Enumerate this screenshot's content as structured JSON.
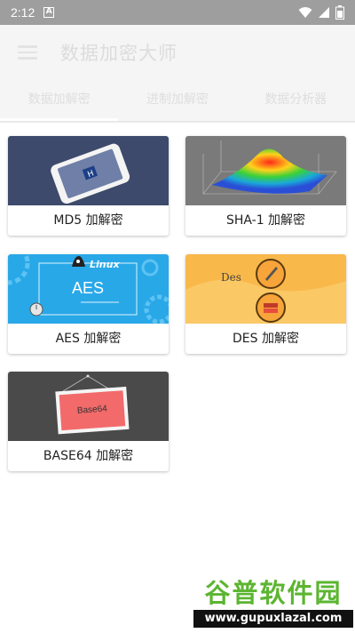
{
  "status_bar": {
    "time": "2:12",
    "notification_letter": "A"
  },
  "app_bar": {
    "title": "数据加密大师"
  },
  "tabs": [
    {
      "label": "数据加解密",
      "selected": true
    },
    {
      "label": "进制加解密",
      "selected": false
    },
    {
      "label": "数据分析器",
      "selected": false
    }
  ],
  "cards": [
    {
      "label": "MD5 加解密",
      "image": "phone-icon"
    },
    {
      "label": "SHA-1 加解密",
      "image": "3d-surface-plot"
    },
    {
      "label": "AES 加解密",
      "image": "linux-gear-banner",
      "image_text": {
        "brand": "Linux",
        "name": "AES"
      }
    },
    {
      "label": "DES 加解密",
      "image": "des-banner",
      "image_text": {
        "name": "Des"
      }
    },
    {
      "label": "BASE64 加解密",
      "image": "picture-frame",
      "image_text": {
        "frame": "Base64"
      }
    }
  ],
  "watermark": {
    "title": "谷普软件园",
    "url": "www.gupuxlazal.com"
  },
  "colors": {
    "status_bar": "#9e9e9e",
    "app_bar": "#f5f5f5",
    "md5_bg": "#3d4a6b",
    "sha_bg": "#7a7a7a",
    "aes_bg": "#29a8e8",
    "des_bg": "#f9b84a",
    "base64_bg": "#4a4a4a",
    "watermark_green": "#5cb531"
  }
}
